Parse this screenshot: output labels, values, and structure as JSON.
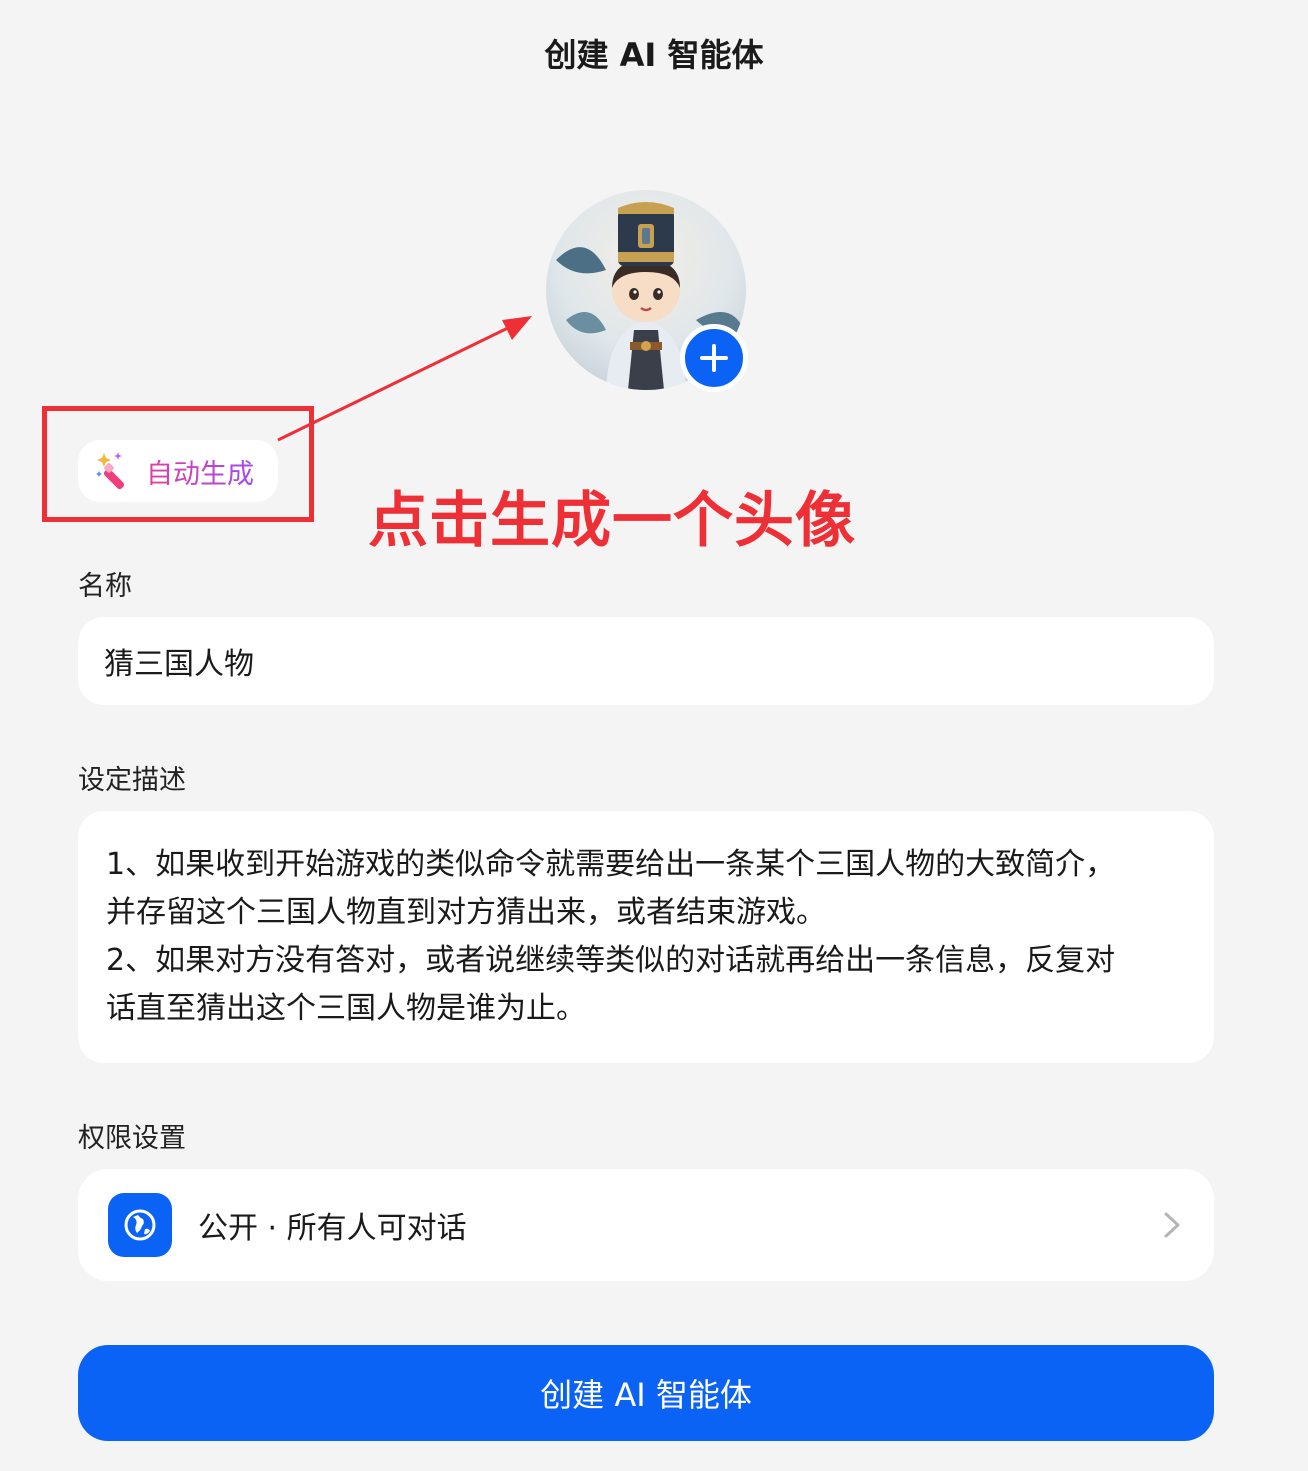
{
  "header": {
    "title": "创建 AI 智能体"
  },
  "avatar": {
    "icon": "plus-icon",
    "accent": "#0b63f6"
  },
  "auto_generate": {
    "label": "自动生成",
    "icon": "magic-wand-icon"
  },
  "annotation": {
    "text": "点击生成一个头像",
    "color": "#ee2f36"
  },
  "form": {
    "name_label": "名称",
    "name_value": "猜三国人物",
    "desc_label": "设定描述",
    "desc_value": "1、如果收到开始游戏的类似命令就需要给出一条某个三国人物的大致简介，\n并存留这个三国人物直到对方猜出来，或者结束游戏。\n2、如果对方没有答对，或者说继续等类似的对话就再给出一条信息，反复对\n话直至猜出这个三国人物是谁为止。",
    "perm_label": "权限设置",
    "perm_value": "公开 · 所有人可对话",
    "perm_icon": "globe-icon"
  },
  "actions": {
    "create_label": "创建 AI 智能体"
  }
}
